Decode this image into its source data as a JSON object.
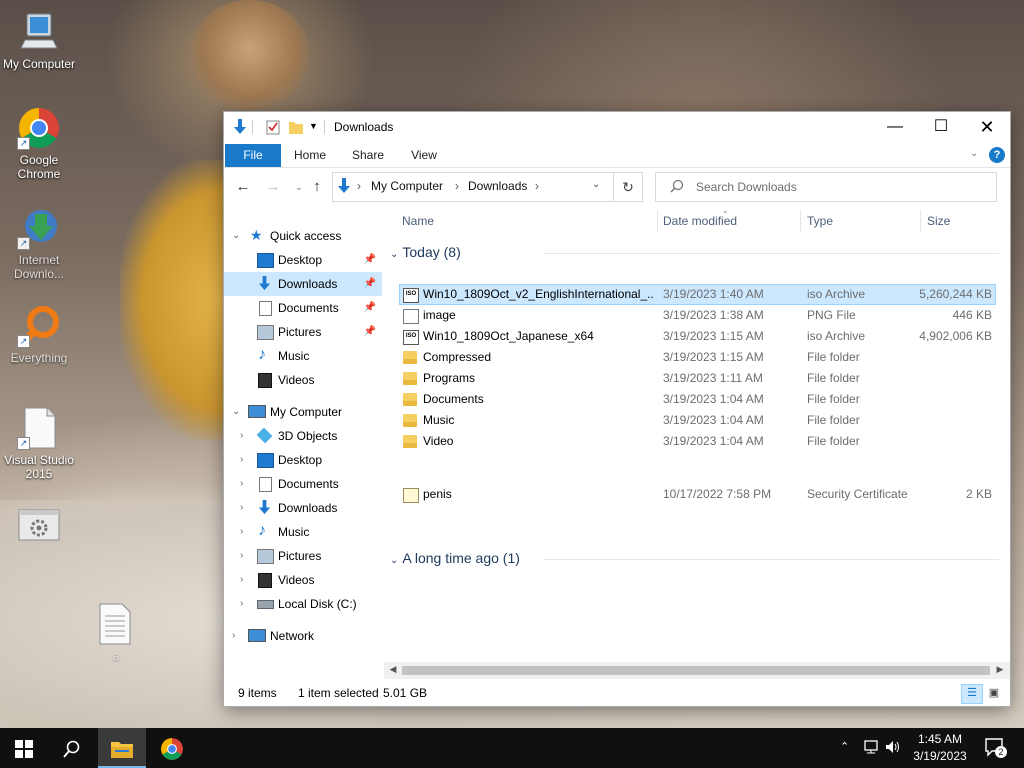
{
  "desktop": {
    "icons": [
      {
        "label": "My Computer"
      },
      {
        "label": "Google Chrome"
      },
      {
        "label": "Internet Downlo..."
      },
      {
        "label": "Everything"
      },
      {
        "label": "Visual Studio 2015"
      },
      {
        "label": ""
      },
      {
        "label": "a"
      }
    ]
  },
  "window": {
    "title": "Downloads",
    "ribbon_tabs": [
      "File",
      "Home",
      "Share",
      "View"
    ],
    "address": {
      "crumbs": [
        "My Computer",
        "Downloads"
      ]
    },
    "search_placeholder": "Search Downloads",
    "nav": {
      "quick_access": "Quick access",
      "quick_items": [
        "Desktop",
        "Downloads",
        "Documents",
        "Pictures",
        "Music",
        "Videos"
      ],
      "computer": "My Computer",
      "computer_items": [
        "3D Objects",
        "Desktop",
        "Documents",
        "Downloads",
        "Music",
        "Pictures",
        "Videos",
        "Local Disk (C:)"
      ],
      "network": "Network"
    },
    "columns": {
      "name": "Name",
      "date": "Date modified",
      "type": "Type",
      "size": "Size"
    },
    "groups": [
      {
        "label": "Today (8)",
        "files": [
          {
            "name": "Win10_1809Oct_v2_EnglishInternational_...",
            "date": "3/19/2023 1:40 AM",
            "type": "iso Archive",
            "size": "5,260,244 KB",
            "icon": "iso-icon",
            "selected": true
          },
          {
            "name": "image",
            "date": "3/19/2023 1:38 AM",
            "type": "PNG File",
            "size": "446 KB",
            "icon": "png-icon"
          },
          {
            "name": "Win10_1809Oct_Japanese_x64",
            "date": "3/19/2023 1:15 AM",
            "type": "iso Archive",
            "size": "4,902,006 KB",
            "icon": "iso-icon"
          },
          {
            "name": "Compressed",
            "date": "3/19/2023 1:15 AM",
            "type": "File folder",
            "size": "",
            "icon": "folder-icon"
          },
          {
            "name": "Programs",
            "date": "3/19/2023 1:11 AM",
            "type": "File folder",
            "size": "",
            "icon": "folder-icon"
          },
          {
            "name": "Documents",
            "date": "3/19/2023 1:04 AM",
            "type": "File folder",
            "size": "",
            "icon": "folder-icon"
          },
          {
            "name": "Music",
            "date": "3/19/2023 1:04 AM",
            "type": "File folder",
            "size": "",
            "icon": "folder-icon"
          },
          {
            "name": "Video",
            "date": "3/19/2023 1:04 AM",
            "type": "File folder",
            "size": "",
            "icon": "folder-icon"
          }
        ]
      },
      {
        "label": "A long time ago (1)",
        "files": [
          {
            "name": "penis",
            "date": "10/17/2022 7:58 PM",
            "type": "Security Certificate",
            "size": "2 KB",
            "icon": "certificate-icon"
          }
        ]
      }
    ],
    "status": {
      "items": "9 items",
      "selection": "1 item selected",
      "size": "5.01 GB"
    }
  },
  "taskbar": {
    "time": "1:45 AM",
    "date": "3/19/2023",
    "notification_count": "2"
  },
  "colors": {
    "accent": "#1979ca",
    "selection": "#cce8ff",
    "taskbar": "#101010"
  }
}
